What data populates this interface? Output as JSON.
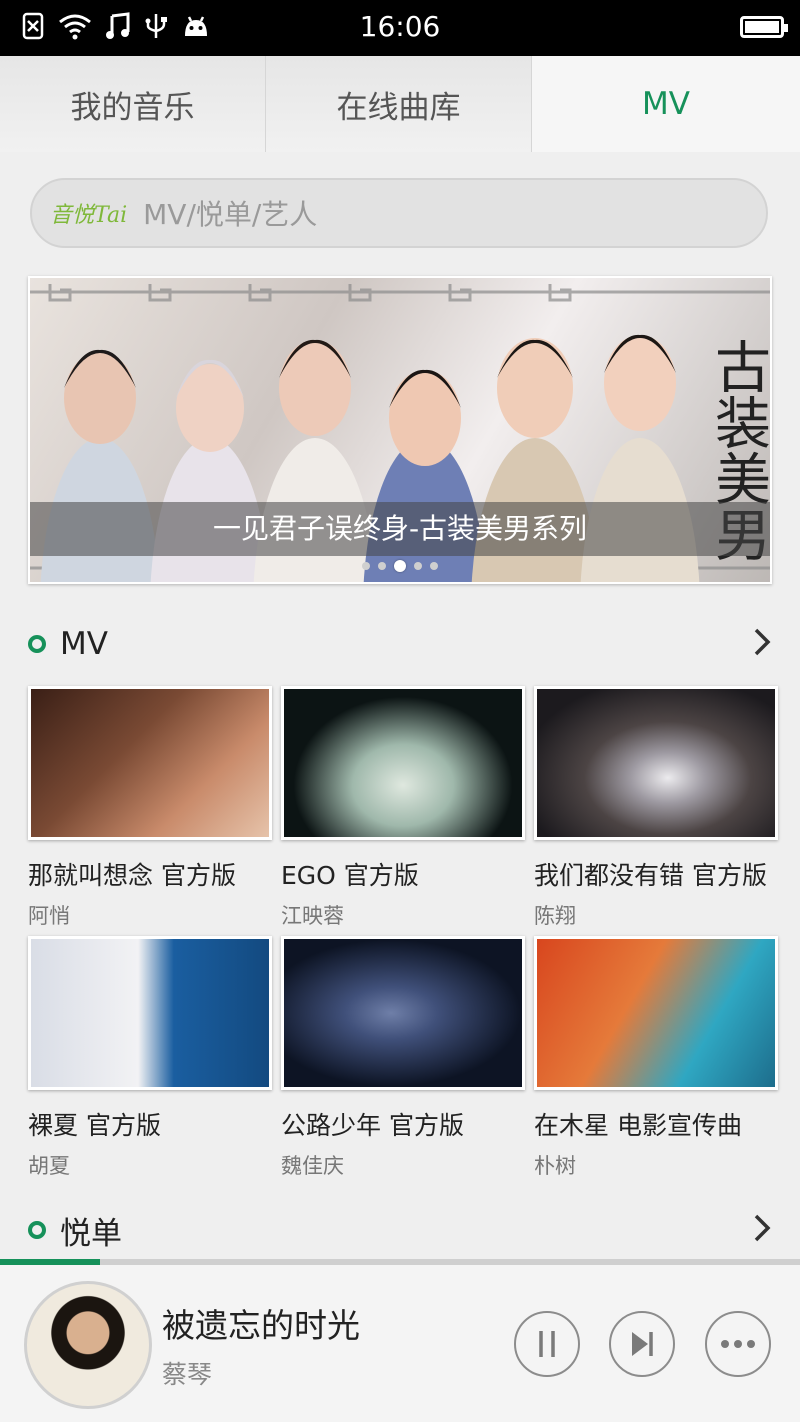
{
  "status_bar": {
    "time": "16:06",
    "icons": [
      "sim-off-icon",
      "wifi-icon",
      "music-note-icon",
      "usb-icon",
      "android-icon",
      "battery-icon"
    ]
  },
  "tabs": [
    {
      "label": "我的音乐",
      "active": false
    },
    {
      "label": "在线曲库",
      "active": false
    },
    {
      "label": "MV",
      "active": true
    }
  ],
  "search": {
    "logo": "音悦Tai",
    "placeholder": "MV/悦单/艺人"
  },
  "banner": {
    "caption": "一见君子误终身-古装美男系列",
    "overlay_text": "古装美男",
    "dots": 5,
    "active_dot": 2
  },
  "mv_section": {
    "title": "MV",
    "items": [
      {
        "title": "那就叫想念 官方版",
        "artist": "阿悄",
        "colors": [
          "#3a1f16",
          "#c98b6b"
        ]
      },
      {
        "title": "EGO 官方版",
        "artist": "江映蓉",
        "colors": [
          "#0c1414",
          "#9fb8ab"
        ]
      },
      {
        "title": "我们都没有错 官方版",
        "artist": "陈翔",
        "colors": [
          "#1c1a1e",
          "#4c4444"
        ]
      },
      {
        "title": "裸夏 官方版",
        "artist": "胡夏",
        "colors": [
          "#1a5ea0",
          "#d9dde6"
        ]
      },
      {
        "title": "公路少年 官方版",
        "artist": "魏佳庆",
        "colors": [
          "#0d1424",
          "#40507a"
        ]
      },
      {
        "title": "在木星 电影宣传曲",
        "artist": "朴树",
        "colors": [
          "#d8461e",
          "#2fa7c2"
        ]
      }
    ]
  },
  "yuedan_section": {
    "title": "悦单"
  },
  "player": {
    "song_title": "被遗忘的时光",
    "artist": "蔡琴",
    "progress": 0.125,
    "accent": "#16915a"
  }
}
